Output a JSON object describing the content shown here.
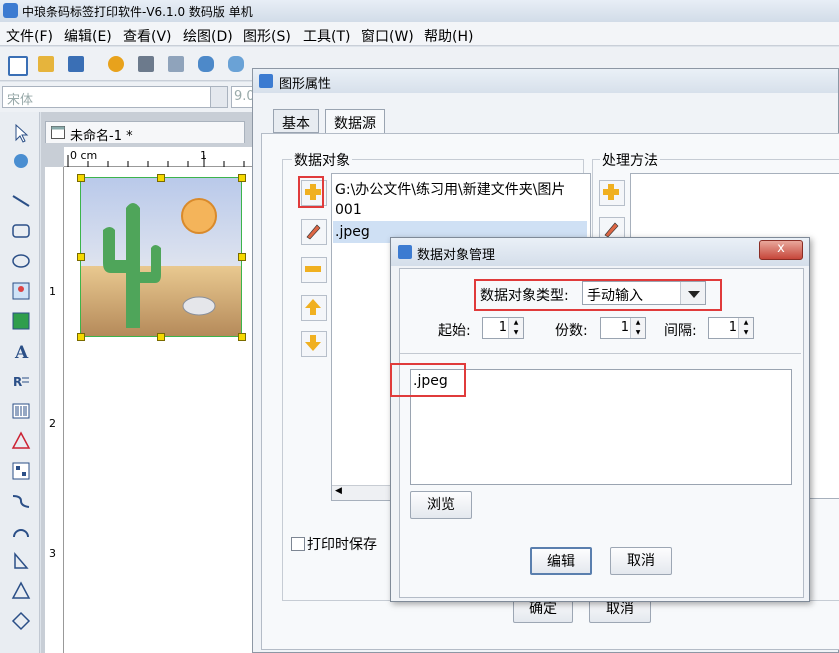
{
  "app": {
    "title": "中琅条码标签打印软件-V6.1.0 数码版 单机"
  },
  "menu": [
    "文件(F)",
    "编辑(E)",
    "查看(V)",
    "绘图(D)",
    "图形(S)",
    "工具(T)",
    "窗口(W)",
    "帮助(H)"
  ],
  "font_row": {
    "font": "宋体",
    "size": "9.0"
  },
  "document_tab": {
    "title": "未命名-1 *"
  },
  "ruler": {
    "h_unit": "0 cm",
    "h_mark": "1",
    "v_marks": [
      "1",
      "2",
      "3"
    ]
  },
  "dialog_props": {
    "title": "图形属性",
    "tabs": [
      "基本",
      "数据源"
    ],
    "active_tab": "数据源",
    "data_objects_label": "数据对象",
    "processing_label": "处理方法",
    "list_items": [
      "G:\\办公文件\\练习用\\新建文件夹\\图片",
      "001",
      ".jpeg"
    ],
    "selected_index": 2,
    "save_on_print_label": "打印时保存",
    "ok_label": "确定",
    "cancel_label": "取消"
  },
  "dialog_manage": {
    "title": "数据对象管理",
    "close_label": "x",
    "type_label": "数据对象类型:",
    "type_value": "手动输入",
    "start_label": "起始:",
    "start_value": "1",
    "copies_label": "份数:",
    "copies_value": "1",
    "interval_label": "间隔:",
    "interval_value": "1",
    "text_value": ".jpeg",
    "browse_label": "浏览",
    "edit_label": "编辑",
    "cancel_label": "取消"
  },
  "colors": {
    "highlight": "#e03b3b",
    "selection": "#cfe0f4",
    "accent": "#3c7bd1"
  }
}
